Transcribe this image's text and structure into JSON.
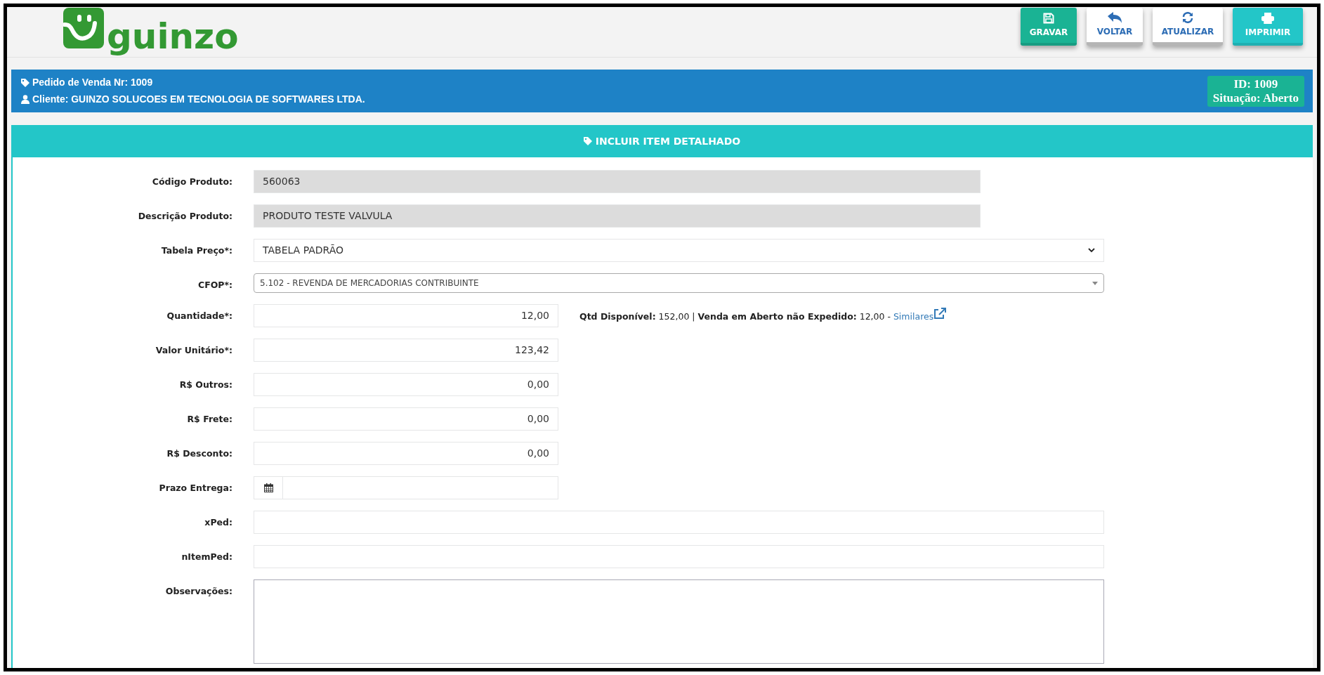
{
  "logo": {
    "text": "guinzo"
  },
  "toolbar": [
    {
      "label": "GRAVAR",
      "kind": "save"
    },
    {
      "label": "VOLTAR",
      "kind": "back"
    },
    {
      "label": "ATUALIZAR",
      "kind": "refresh"
    },
    {
      "label": "IMPRIMIR",
      "kind": "print"
    }
  ],
  "order_bar": {
    "order": "Pedido de Venda Nr: 1009",
    "client": "Cliente: GUINZO SOLUCOES EM TECNOLOGIA DE SOFTWARES LTDA.",
    "id": "ID: 1009",
    "status": "Situação: Aberto"
  },
  "panel": {
    "title": "INCLUIR ITEM DETALHADO"
  },
  "fields": [
    {
      "label": "Código Produto:",
      "kind": "readonly",
      "value": "560063"
    },
    {
      "label": "Descrição Produto:",
      "kind": "readonly",
      "value": "PRODUTO TESTE VALVULA"
    },
    {
      "label": "Tabela Preço*:",
      "kind": "select",
      "value": "TABELA PADRÃO"
    },
    {
      "label": "CFOP*:",
      "kind": "combo",
      "value": "5.102 - REVENDA DE MERCADORIAS CONTRIBUINTE"
    },
    {
      "label": "Quantidade*:",
      "kind": "number",
      "value": "12,00",
      "info": "**Qtd Disponível:** 152,00 | **Venda em Aberto não Expedido:** 12,00 - ",
      "link": "Similares"
    },
    {
      "label": "Valor Unitário*:",
      "kind": "number",
      "value": "123,42"
    },
    {
      "label": "R$ Outros:",
      "kind": "number",
      "value": "0,00"
    },
    {
      "label": "R$ Frete:",
      "kind": "number",
      "value": "0,00"
    },
    {
      "label": "R$ Desconto:",
      "kind": "number",
      "value": "0,00"
    },
    {
      "label": "Prazo Entrega:",
      "kind": "date"
    },
    {
      "label": "xPed:",
      "kind": "text"
    },
    {
      "label": "nItemPed:",
      "kind": "text"
    },
    {
      "label": "Observações:",
      "kind": "textarea"
    }
  ]
}
